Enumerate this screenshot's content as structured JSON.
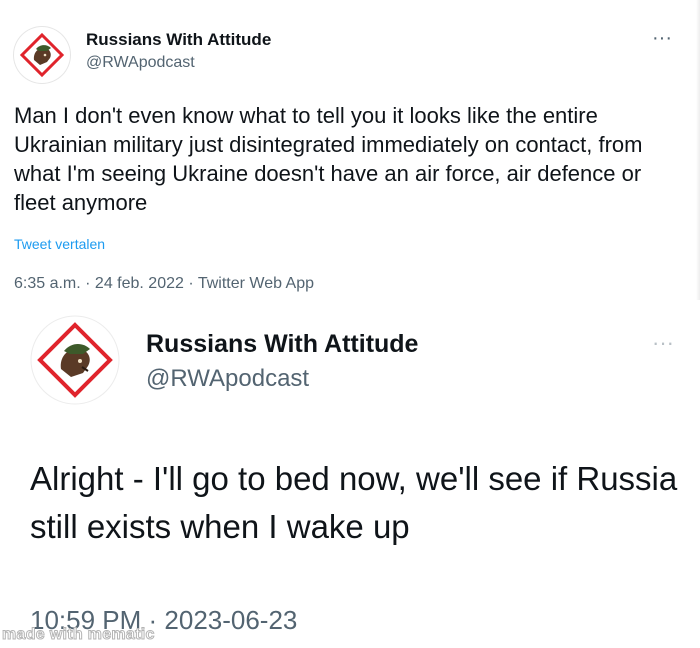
{
  "tweet1": {
    "display_name": "Russians With Attitude",
    "handle": "@RWApodcast",
    "more": "···",
    "text": "Man I don't even know what to tell you it looks like the entire Ukrainian military just disintegrated immediately on contact, from what I'm seeing Ukraine doesn't have an air force, air defence or fleet anymore",
    "translate": "Tweet vertalen",
    "meta": "6:35 a.m. · 24 feb. 2022 · Twitter Web App"
  },
  "tweet2": {
    "display_name": "Russians With Attitude",
    "handle": "@RWApodcast",
    "more": "···",
    "text": "Alright - I'll go to bed now, we'll see if Russia still exists when I wake up",
    "meta": "10:59 PM · 2023-06-23"
  },
  "watermark": "made with mematic",
  "colors": {
    "handle": "#536471",
    "link": "#1d9bf0",
    "text": "#0f1419",
    "avatar_border": "#e0242c"
  },
  "icons": {
    "avatar": "rwa-logo-icon",
    "more": "more-dots-icon"
  }
}
